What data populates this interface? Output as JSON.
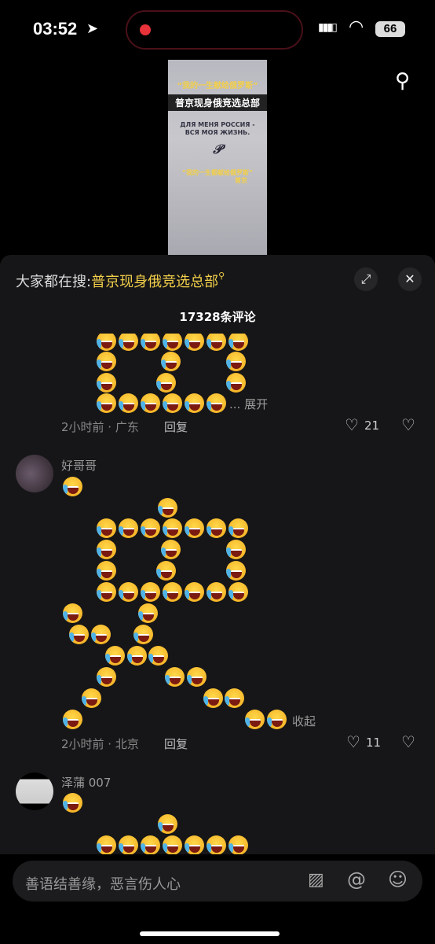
{
  "status_bar": {
    "time": "03:52",
    "battery": "66",
    "recording_color": "#e8333a"
  },
  "video": {
    "line1": "“我的一生献给俄罗斯”",
    "line2": "普京现身俄竞选总部",
    "line3": "ДЛЯ МЕНЯ РОССИЯ -",
    "line4": "ВСЯ МОЯ ЖИЗНЬ.",
    "line5": "“我的一生都献给俄罗斯”",
    "line6": "普京"
  },
  "header": {
    "search_prefix": "大家都在搜:",
    "search_keyword": "普京现身俄竞选总部",
    "comment_count": "17328条评论"
  },
  "comments": [
    {
      "user": "",
      "time_location": "2小时前 · 广东",
      "reply": "回复",
      "likes": "21",
      "toggle": "... 展开"
    },
    {
      "user": "好哥哥",
      "time_location": "2小时前 · 北京",
      "reply": "回复",
      "likes": "11",
      "toggle": "收起"
    },
    {
      "user": "泽蒲 007"
    }
  ],
  "input": {
    "placeholder": "善语结善缘，恶言伤人心"
  },
  "accent": "#f2cf4a"
}
